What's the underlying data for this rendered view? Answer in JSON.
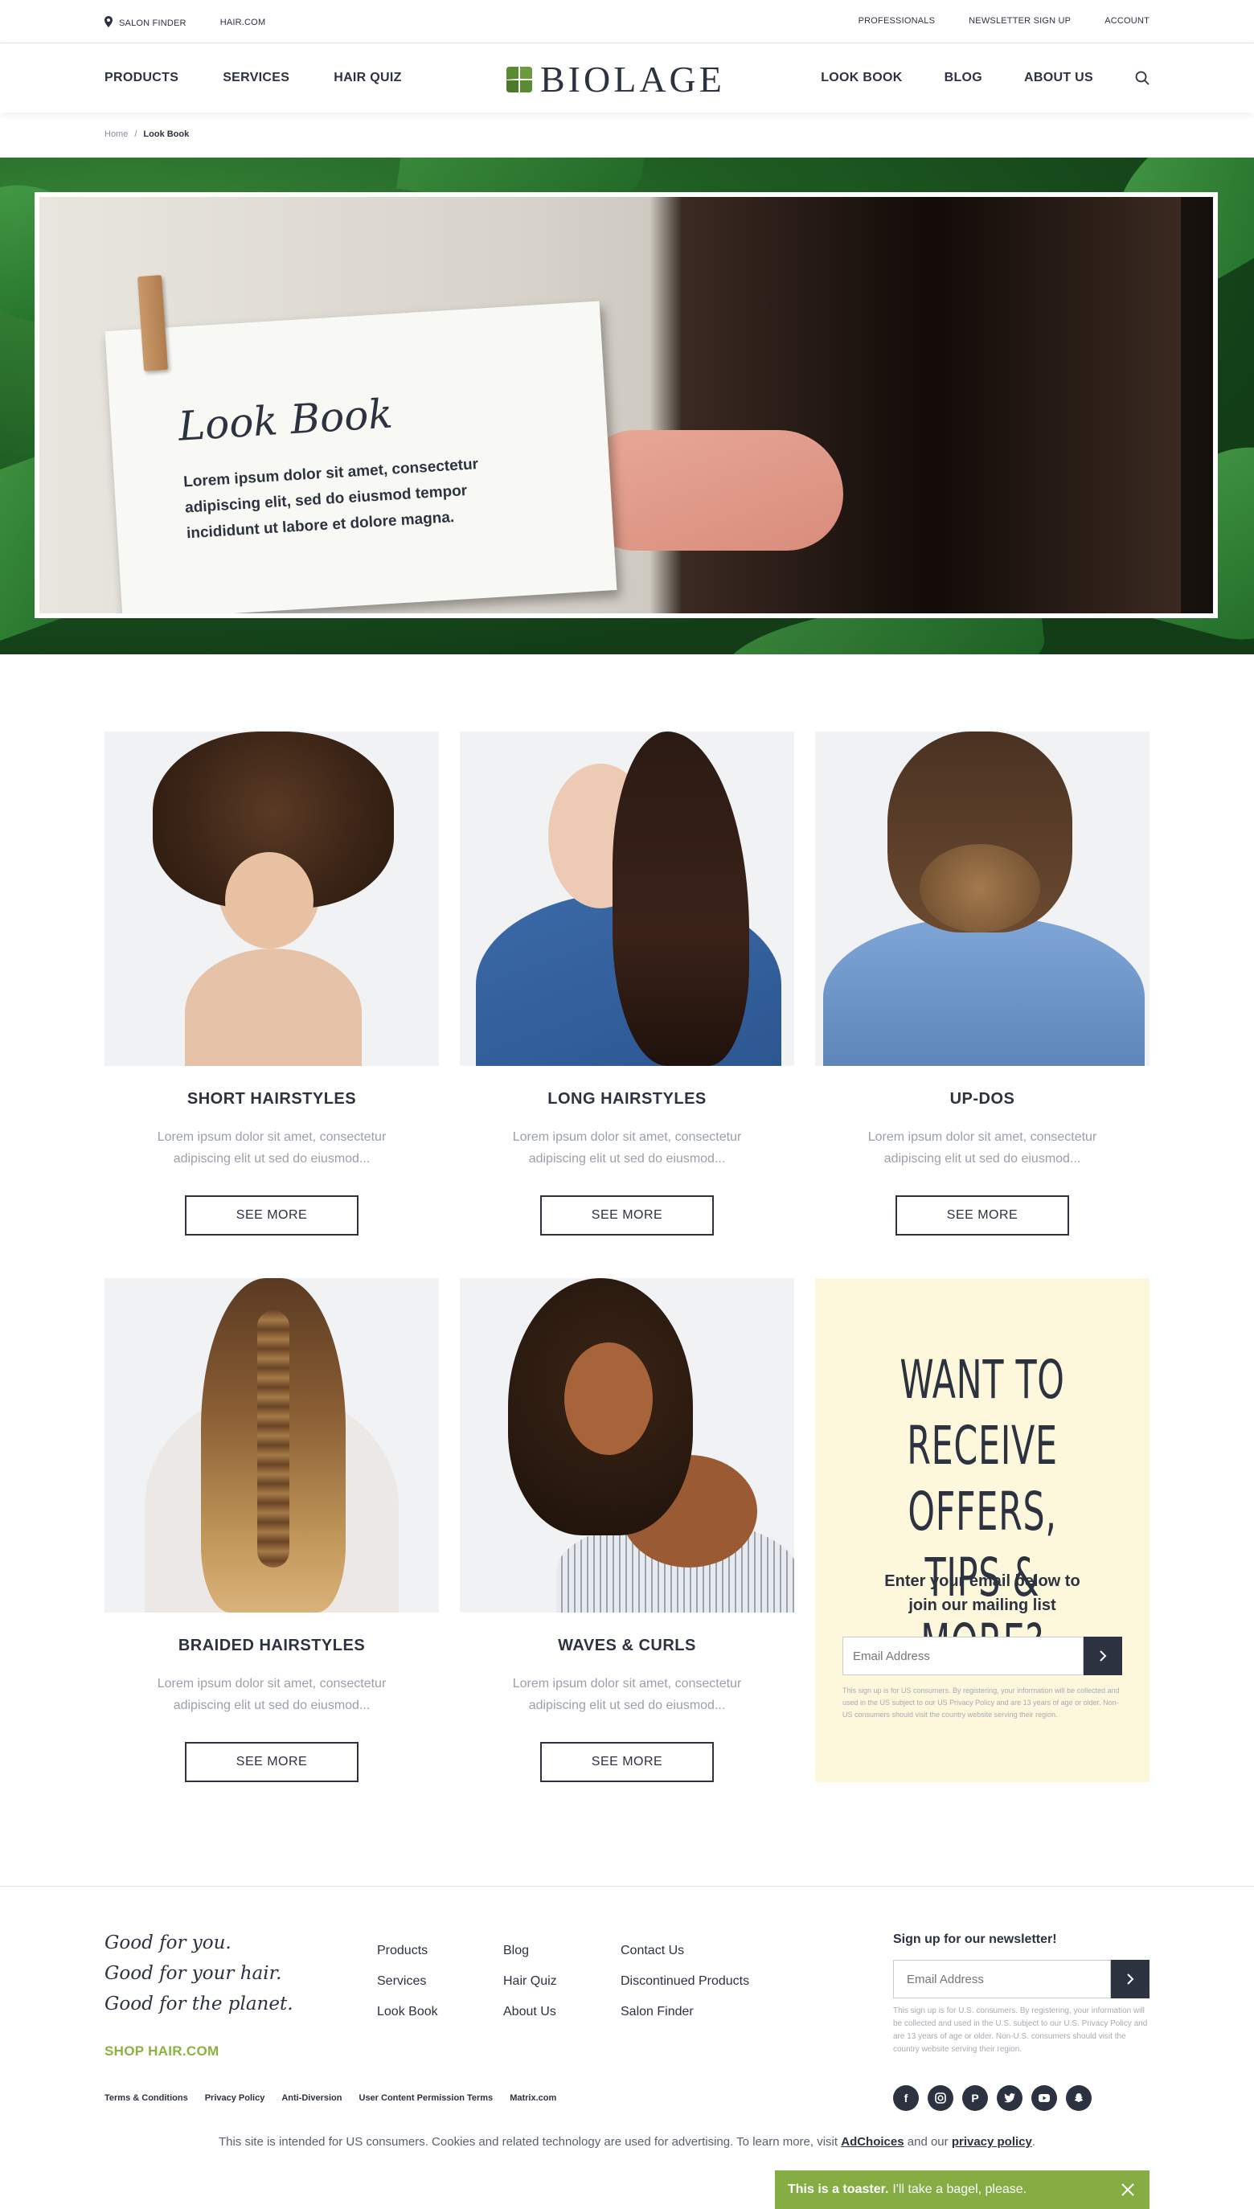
{
  "topbar": {
    "left": [
      "SALON FINDER",
      "HAIR.COM"
    ],
    "right": [
      "PROFESSIONALS",
      "NEWSLETTER SIGN UP",
      "ACCOUNT"
    ]
  },
  "nav": {
    "left": [
      "PRODUCTS",
      "SERVICES",
      "HAIR QUIZ"
    ],
    "right": [
      "LOOK BOOK",
      "BLOG",
      "ABOUT US"
    ],
    "logo": "BIOLAGE"
  },
  "breadcrumb": {
    "home": "Home",
    "sep": "/",
    "current": "Look Book"
  },
  "hero": {
    "title": "Look Book",
    "body": "Lorem ipsum dolor sit amet, consectetur adipiscing elit, sed do eiusmod tempor incididunt ut labore et dolore magna."
  },
  "cards": [
    {
      "title": "SHORT HAIRSTYLES",
      "desc": "Lorem ipsum dolor sit amet, consectetur adipiscing elit ut sed do eiusmod...",
      "button": "SEE MORE"
    },
    {
      "title": "LONG HAIRSTYLES",
      "desc": "Lorem ipsum dolor sit amet, consectetur adipiscing elit ut sed do eiusmod...",
      "button": "SEE MORE"
    },
    {
      "title": "UP-DOS",
      "desc": "Lorem ipsum dolor sit amet, consectetur adipiscing elit ut sed do eiusmod...",
      "button": "SEE MORE"
    },
    {
      "title": "BRAIDED HAIRSTYLES",
      "desc": "Lorem ipsum dolor sit amet, consectetur adipiscing elit ut sed do eiusmod...",
      "button": "SEE MORE"
    },
    {
      "title": "WAVES & CURLS",
      "desc": "Lorem ipsum dolor sit amet, consectetur adipiscing elit ut sed do eiusmod...",
      "button": "SEE MORE"
    }
  ],
  "offer": {
    "title_line1": "WANT TO",
    "title_line2": "RECEIVE OFFERS,",
    "title_line3": "TIPS & MORE?",
    "sub": "Enter your email below to join our mailing list",
    "placeholder": "Email Address",
    "fine": "This sign up is for US consumers. By registering, your information will be collected and used in the US subject to our US Privacy Policy and are 13 years of age or older. Non-US consumers should visit the country website serving their region."
  },
  "footer": {
    "tagline1": "Good for you.",
    "tagline2": "Good for your hair.",
    "tagline3": "Good for the planet.",
    "shop": "SHOP HAIR.COM",
    "col1": [
      "Products",
      "Services",
      "Look Book"
    ],
    "col2": [
      "Blog",
      "Hair Quiz",
      "About Us"
    ],
    "col3": [
      "Contact Us",
      "Discontinued Products",
      "Salon Finder"
    ],
    "news_title": "Sign up for our newsletter!",
    "news_placeholder": "Email Address",
    "news_fine": "This sign up is for U.S. consumers. By registering, your information will be collected and used in the U.S. subject to our U.S. Privacy Policy and are 13 years of age or older. Non-U.S. consumers should visit the country website serving their region.",
    "social": [
      "facebook-icon",
      "instagram-icon",
      "pinterest-icon",
      "twitter-icon",
      "youtube-icon",
      "snapchat-icon"
    ],
    "legal": [
      "Terms & Conditions",
      "Privacy Policy",
      "Anti-Diversion",
      "User Content Permission Terms",
      "Matrix.com"
    ],
    "notice_before": "This site is intended for US consumers. Cookies and related technology are used for advertising. To learn more, visit ",
    "notice_link1": "AdChoices",
    "notice_mid": " and our ",
    "notice_link2": "privacy policy",
    "notice_after": "."
  },
  "toaster": {
    "bold": "This is a toaster.",
    "text": "I'll take a bagel, please."
  },
  "colors": {
    "ink": "#2c3240",
    "brand_green": "#5a8a32",
    "toaster": "#86ad44",
    "offer_bg": "#fdf8dc"
  }
}
